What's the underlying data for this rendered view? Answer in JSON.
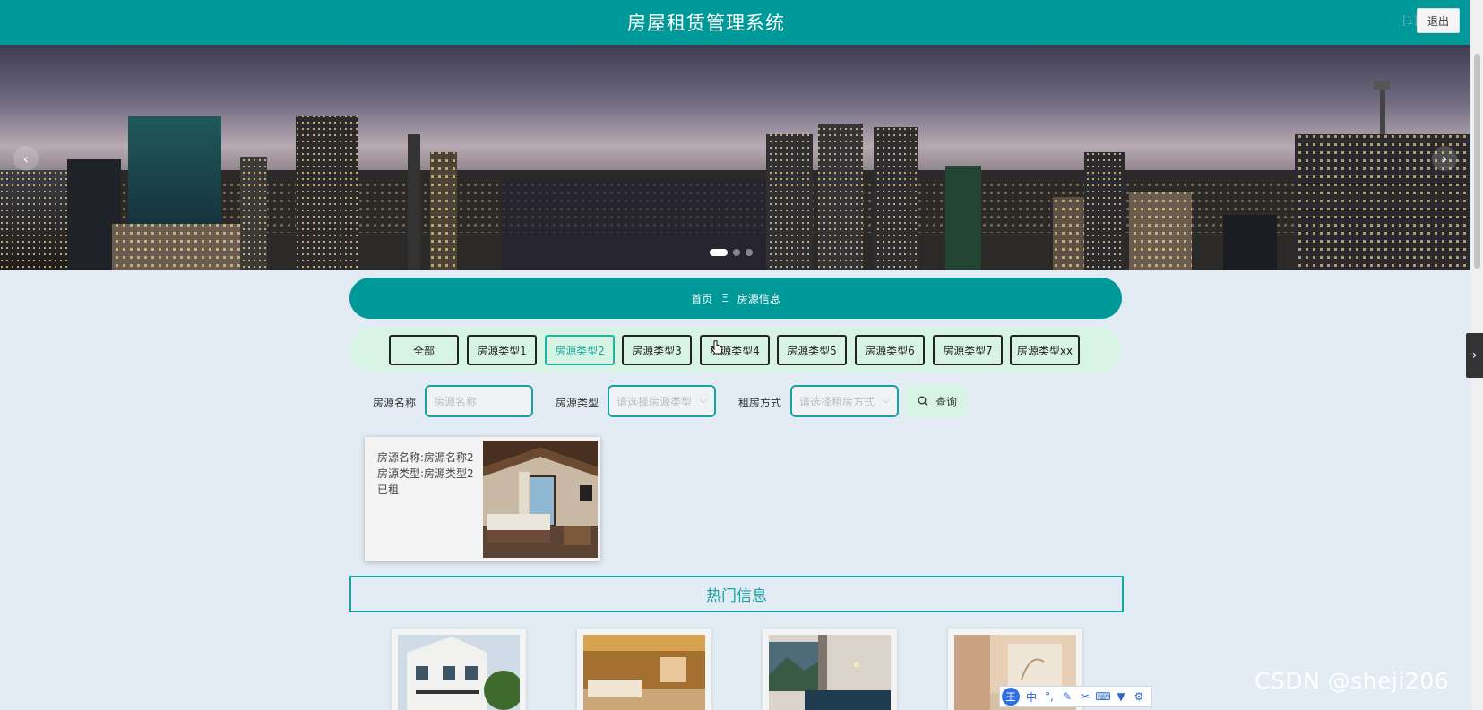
{
  "header": {
    "title": "房屋租赁管理系统",
    "user": "[1]",
    "logout_label": "退出"
  },
  "banner": {
    "prev_icon": "‹",
    "next_icon": "›",
    "slide_count": 3,
    "active_slide": 1
  },
  "breadcrumb": {
    "home": "首页",
    "separator": "Ξ",
    "current": "房源信息"
  },
  "types": [
    {
      "label": "全部",
      "active": false
    },
    {
      "label": "房源类型1",
      "active": false
    },
    {
      "label": "房源类型2",
      "active": true
    },
    {
      "label": "房源类型3",
      "active": false
    },
    {
      "label": "房源类型4",
      "active": false
    },
    {
      "label": "房源类型5",
      "active": false
    },
    {
      "label": "房源类型6",
      "active": false
    },
    {
      "label": "房源类型7",
      "active": false
    },
    {
      "label": "房源类型xx",
      "active": false
    }
  ],
  "search": {
    "name_label": "房源名称",
    "name_placeholder": "房源名称",
    "type_label": "房源类型",
    "type_placeholder": "请选择房源类型",
    "mode_label": "租房方式",
    "mode_placeholder": "请选择租房方式",
    "query_label": "查询"
  },
  "listing": {
    "name_line": "房源名称:房源名称2",
    "type_line": "房源类型:房源类型2",
    "status": "已租"
  },
  "hot": {
    "title": "热门信息",
    "items": [
      {
        "icon": "house-exterior-photo"
      },
      {
        "icon": "bedroom-photo"
      },
      {
        "icon": "hotel-room-photo"
      },
      {
        "icon": "suite-photo"
      }
    ]
  },
  "ime": {
    "logo": "王",
    "mode": "中",
    "icons": [
      "punctuation-icon",
      "pen-icon",
      "scissors-icon",
      "keyboard-icon",
      "shirt-icon",
      "gear-icon"
    ]
  },
  "watermark": "CSDN @sheji206",
  "side_toggle": "›",
  "colors": {
    "primary": "#009999",
    "filter_bg": "#d6f3e3",
    "page_bg": "#e3ecf5"
  }
}
